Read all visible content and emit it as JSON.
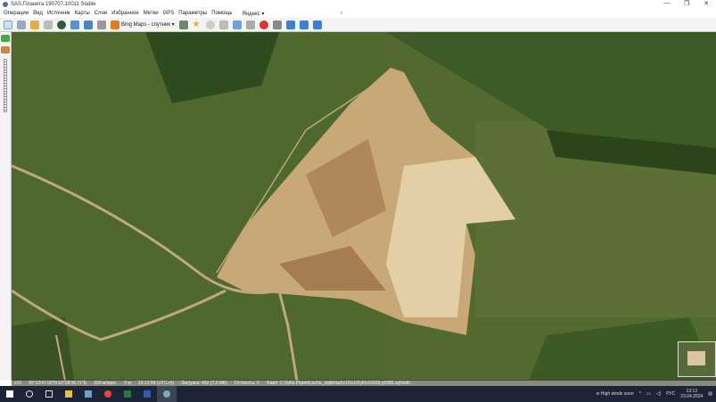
{
  "window": {
    "title": "SAS.Планета 190707.10011 Stable",
    "controls": [
      "—",
      "❐",
      "✕"
    ]
  },
  "menu": [
    "Операции",
    "Вид",
    "Источник",
    "Карты",
    "Слои",
    "Избранное",
    "Метки",
    "GPS",
    "Параметры",
    "Помощь",
    "Яндекс ▾"
  ],
  "toolbar": {
    "map_source": "Bing Maps - спутник ▾"
  },
  "statusbar": {
    "zoom": "z15",
    "coords": "55°13'47.90\"N  63°28'38.71\"E",
    "scale": "300 м/пикс.",
    "distance": "0 м",
    "time": "12:12:59 (UTC+5)",
    "loading": "Загрузка: 492 (7,6 МБ)",
    "remaining": "Осталось: 0",
    "path": "Файл: C:\\SAS.Planet\\cache_sqlite\\sat\\z15\\x10\\y6\\x10439.y5986.sqlitedb"
  },
  "taskbar": {
    "weather": "High winds soon",
    "lang": "РУС",
    "time": "13:13",
    "date": "23.04.2024"
  },
  "colors": {
    "taskbar": "#1c2536",
    "accent": "#2a7ad5"
  }
}
